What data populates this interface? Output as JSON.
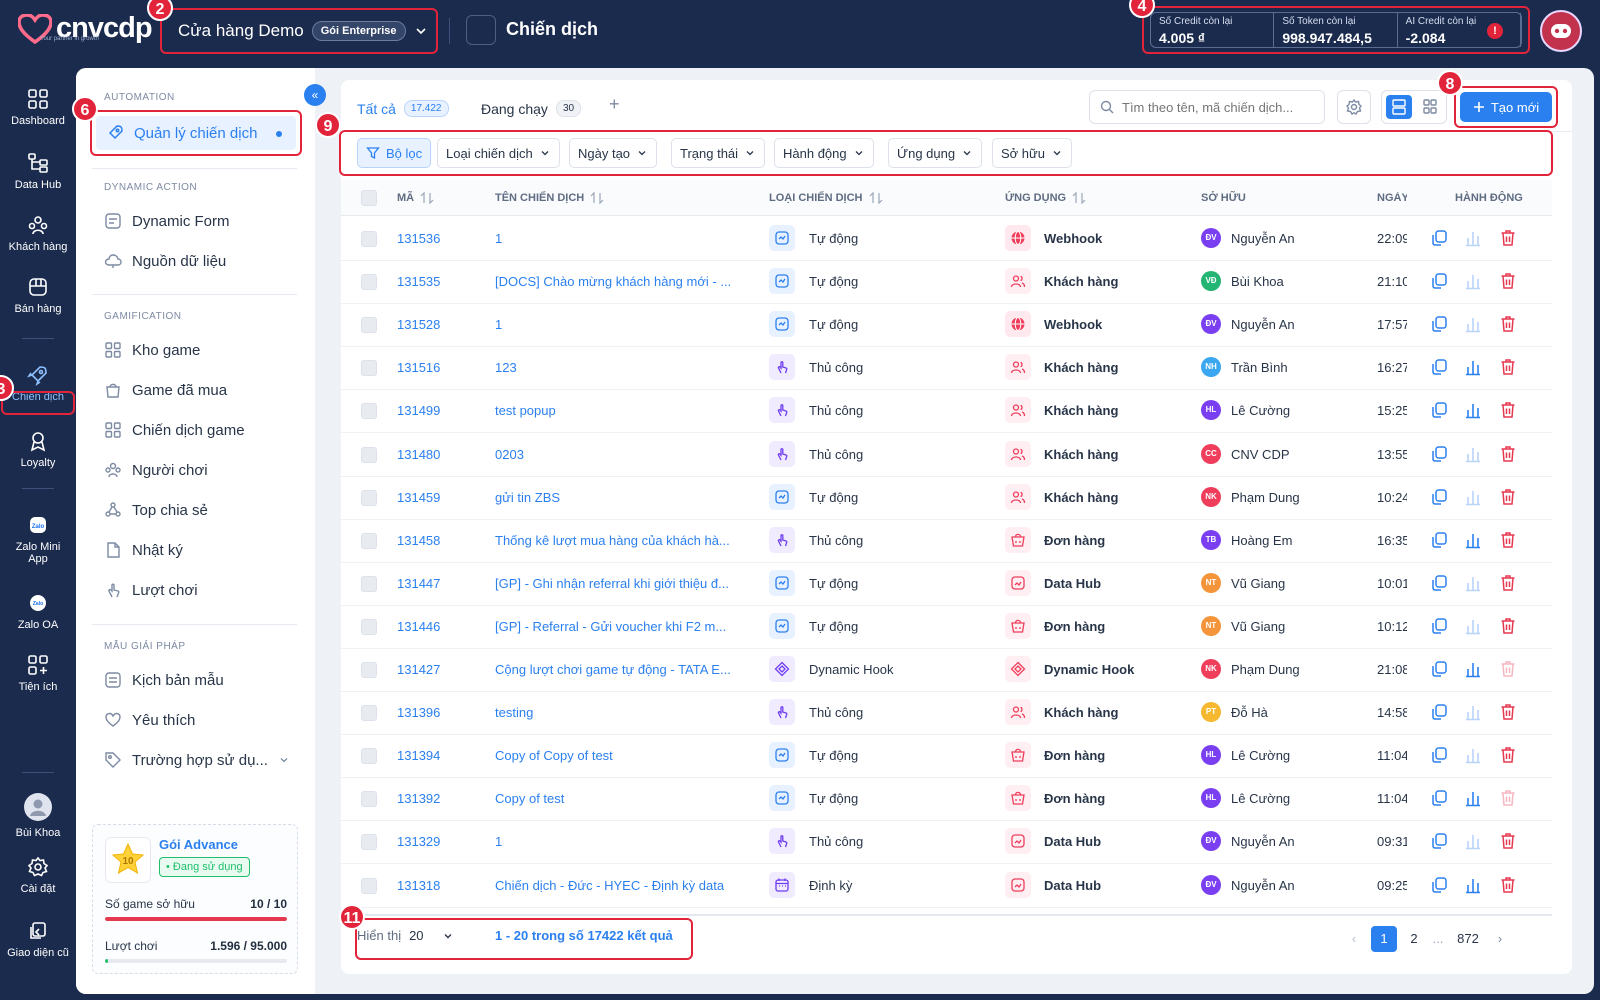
{
  "brand": {
    "logo_text": "cnvcdp",
    "tagline": "Your partner in growth"
  },
  "header": {
    "store_name": "Cửa hàng Demo",
    "plan_badge": "Gói Enterprise",
    "page_title": "Chiến dịch",
    "credits": [
      {
        "label": "Số Credit còn lại",
        "value": "4.005 ₫"
      },
      {
        "label": "Số Token còn lại",
        "value": "998.947.484,5"
      },
      {
        "label": "AI Credit còn lại",
        "value": "-2.084"
      }
    ],
    "info_symbol": "!"
  },
  "markers": [
    "2",
    "4",
    "6",
    "8",
    "9",
    "3",
    "11"
  ],
  "rail": [
    {
      "label": "Dashboard",
      "icon": "dashboard-icon"
    },
    {
      "label": "Data Hub",
      "icon": "data-hub-icon"
    },
    {
      "label": "Khách hàng",
      "icon": "customers-icon"
    },
    {
      "label": "Bán hàng",
      "icon": "sales-icon"
    },
    {
      "label": "Chiến dịch",
      "icon": "rocket-icon",
      "active": true
    },
    {
      "label": "Loyalty",
      "icon": "loyalty-icon"
    },
    {
      "label": "Zalo Mini App",
      "icon": "zalo-mini-app-icon"
    },
    {
      "label": "Zalo OA",
      "icon": "zalo-oa-icon"
    },
    {
      "label": "Tiện ích",
      "icon": "utilities-icon"
    },
    {
      "label": "Bùi Khoa",
      "icon": "user-avatar-icon"
    },
    {
      "label": "Cài đặt",
      "icon": "settings-icon"
    },
    {
      "label": "Giao diện cũ",
      "icon": "old-ui-icon"
    }
  ],
  "sidebar": {
    "collapse_symbol": "«",
    "sections": {
      "automation": "AUTOMATION",
      "dynamic_action": "DYNAMIC ACTION",
      "gamification": "GAMIFICATION",
      "solutions": "MẪU GIẢI PHÁP"
    },
    "items": {
      "campaign_mgmt": "Quản lý chiến dịch",
      "dynamic_form": "Dynamic Form",
      "data_source": "Nguồn dữ liệu",
      "game_store": "Kho game",
      "bought_games": "Game đã mua",
      "game_campaigns": "Chiến dịch game",
      "players": "Người chơi",
      "top_share": "Top chia sẻ",
      "logs": "Nhật ký",
      "plays": "Lượt chơi",
      "templates": "Kịch bản mẫu",
      "favorites": "Yêu thích",
      "use_cases": "Trường hợp sử dụ..."
    },
    "package": {
      "star_value": "10",
      "name": "Gói Advance",
      "status": "• Đang sử dụng",
      "games_label": "Số game sở hữu",
      "games_value": "10 / 10",
      "games_fraction": 1.0,
      "plays_label": "Lượt chơi",
      "plays_value": "1.596 / 95.000",
      "plays_fraction": 0.017
    }
  },
  "tabs": [
    {
      "label": "Tất cả",
      "count": "17.422",
      "active": true
    },
    {
      "label": "Đang chạy",
      "count": "30",
      "active": false
    }
  ],
  "add_tab_symbol": "+",
  "search": {
    "placeholder": "Tìm theo tên, mã chiến dịch..."
  },
  "create_button": "Tạo mới",
  "filters": [
    "Bộ lọc",
    "Loại chiến dịch",
    "Ngày tạo",
    "Trạng thái",
    "Hành động",
    "Ứng dụng",
    "Sở hữu"
  ],
  "columns": [
    "MÃ",
    "TÊN CHIẾN DỊCH",
    "LOẠI CHIẾN DỊCH",
    "ỨNG DỤNG",
    "SỞ HỮU",
    "NGÀY",
    "HÀNH ĐỘNG"
  ],
  "rows": [
    {
      "id": "131536",
      "name": "1",
      "type": "Tự động",
      "app": "Webhook",
      "owner_initials": "ĐV",
      "owner": "Nguyễn An",
      "owner_color": "#7b3ff2",
      "time": "22:09",
      "stats_active": false,
      "delete_active": true
    },
    {
      "id": "131535",
      "name": "[DOCS] Chào mừng khách hàng mới - ...",
      "type": "Tự động",
      "app": "Khách hàng",
      "owner_initials": "VĐ",
      "owner": "Bùi Khoa",
      "owner_color": "#22b573",
      "time": "21:10",
      "stats_active": false,
      "delete_active": true
    },
    {
      "id": "131528",
      "name": "1",
      "type": "Tự động",
      "app": "Webhook",
      "owner_initials": "ĐV",
      "owner": "Nguyễn An",
      "owner_color": "#7b3ff2",
      "time": "17:57",
      "stats_active": false,
      "delete_active": true
    },
    {
      "id": "131516",
      "name": "123",
      "type": "Thủ công",
      "app": "Khách hàng",
      "owner_initials": "NH",
      "owner": "Trần Bình",
      "owner_color": "#3aa7f0",
      "time": "16:27",
      "stats_active": true,
      "delete_active": true
    },
    {
      "id": "131499",
      "name": "test popup",
      "type": "Thủ công",
      "app": "Khách hàng",
      "owner_initials": "HL",
      "owner": "Lê Cường",
      "owner_color": "#7b3ff2",
      "time": "15:25",
      "stats_active": true,
      "delete_active": true
    },
    {
      "id": "131480",
      "name": "0203",
      "type": "Thủ công",
      "app": "Khách hàng",
      "owner_initials": "CC",
      "owner": "CNV CDP",
      "owner_color": "#ef3e5c",
      "time": "13:55",
      "stats_active": false,
      "delete_active": true
    },
    {
      "id": "131459",
      "name": "gửi tin ZBS",
      "type": "Tự động",
      "app": "Khách hàng",
      "owner_initials": "NK",
      "owner": "Phạm Dung",
      "owner_color": "#ef3e5c",
      "time": "10:24",
      "stats_active": false,
      "delete_active": true
    },
    {
      "id": "131458",
      "name": "Thống kê lượt mua hàng của khách hà...",
      "type": "Thủ công",
      "app": "Đơn hàng",
      "owner_initials": "TB",
      "owner": "Hoàng Em",
      "owner_color": "#7b3ff2",
      "time": "16:35",
      "stats_active": true,
      "delete_active": true
    },
    {
      "id": "131447",
      "name": "[GP] - Ghi nhận referral khi giới thiệu đ...",
      "type": "Tự động",
      "app": "Data Hub",
      "owner_initials": "NT",
      "owner": "Vũ Giang",
      "owner_color": "#f5953b",
      "time": "10:01",
      "stats_active": false,
      "delete_active": true
    },
    {
      "id": "131446",
      "name": "[GP] - Referral - Gửi voucher khi F2 m...",
      "type": "Tự động",
      "app": "Đơn hàng",
      "owner_initials": "NT",
      "owner": "Vũ Giang",
      "owner_color": "#f5953b",
      "time": "10:12",
      "stats_active": false,
      "delete_active": true
    },
    {
      "id": "131427",
      "name": "Cộng lượt chơi game tự động - TATA E...",
      "type": "Dynamic Hook",
      "app": "Dynamic Hook",
      "owner_initials": "NK",
      "owner": "Phạm Dung",
      "owner_color": "#ef3e5c",
      "time": "21:08",
      "stats_active": true,
      "delete_active": false
    },
    {
      "id": "131396",
      "name": "testing",
      "type": "Thủ công",
      "app": "Khách hàng",
      "owner_initials": "PT",
      "owner": "Đỗ Hà",
      "owner_color": "#f5b82e",
      "time": "14:58",
      "stats_active": false,
      "delete_active": true
    },
    {
      "id": "131394",
      "name": "Copy of Copy of test",
      "type": "Tự động",
      "app": "Đơn hàng",
      "owner_initials": "HL",
      "owner": "Lê Cường",
      "owner_color": "#7b3ff2",
      "time": "11:04",
      "stats_active": false,
      "delete_active": true
    },
    {
      "id": "131392",
      "name": "Copy of test",
      "type": "Tự động",
      "app": "Đơn hàng",
      "owner_initials": "HL",
      "owner": "Lê Cường",
      "owner_color": "#7b3ff2",
      "time": "11:04",
      "stats_active": true,
      "delete_active": false
    },
    {
      "id": "131329",
      "name": "1",
      "type": "Thủ công",
      "app": "Data Hub",
      "owner_initials": "ĐV",
      "owner": "Nguyễn An",
      "owner_color": "#7b3ff2",
      "time": "09:31",
      "stats_active": false,
      "delete_active": true
    },
    {
      "id": "131318",
      "name": "Chiến dịch - Đức - HYEC - Định kỳ data",
      "type": "Định kỳ",
      "app": "Data Hub",
      "owner_initials": "ĐV",
      "owner": "Nguyễn An",
      "owner_color": "#7b3ff2",
      "time": "09:25",
      "stats_active": true,
      "delete_active": true
    }
  ],
  "footer": {
    "show_label": "Hiển thị",
    "page_size": "20",
    "range_text": "1 - 20 trong số 17422 kết quả",
    "pages": [
      "1",
      "2",
      "...",
      "872"
    ],
    "prev_symbol": "‹",
    "next_symbol": "›"
  },
  "colors": {
    "accent": "#2b80f0",
    "highlight": "#e2243a",
    "navy": "#1b2b4d",
    "danger": "#e53950"
  }
}
